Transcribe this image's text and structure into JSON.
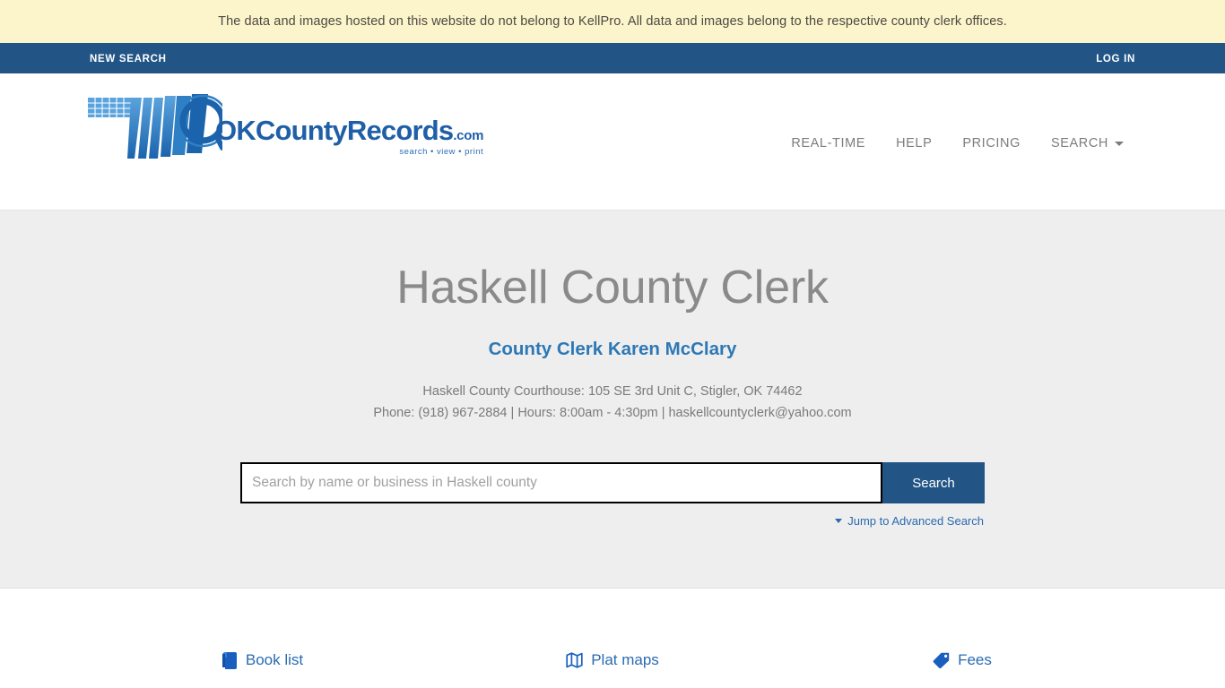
{
  "disclaimer": {
    "text": "The data and images hosted on this website do not belong to KellPro. All data and images belong to the respective county clerk offices."
  },
  "topnav": {
    "new_search_label": "NEW SEARCH",
    "log_in_label": "LOG IN"
  },
  "logo": {
    "word_main": "OKCountyRecords",
    "word_suffix": ".com",
    "tagline": "search • view • print",
    "trademark": "™"
  },
  "menu": {
    "items": [
      {
        "label": "REAL-TIME"
      },
      {
        "label": "HELP"
      },
      {
        "label": "PRICING"
      },
      {
        "label": "SEARCH"
      }
    ]
  },
  "hero": {
    "title": "Haskell County Clerk",
    "clerk_link": "County Clerk Karen McClary",
    "address_line": "Haskell County Courthouse: 105 SE 3rd Unit C, Stigler, OK 74462",
    "contact_line": "Phone: (918) 967-2884 | Hours: 8:00am - 4:30pm | haskellcountyclerk@yahoo.com"
  },
  "search": {
    "placeholder": "Search by name or business in Haskell county",
    "value": "",
    "button_label": "Search",
    "advanced_label": "Jump to Advanced Search"
  },
  "quicklinks": [
    {
      "label": "Book list",
      "icon": "book-icon"
    },
    {
      "label": "Plat maps",
      "icon": "map-icon"
    },
    {
      "label": "Fees",
      "icon": "tag-icon"
    }
  ],
  "colors": {
    "nav_blue": "#225586",
    "banner_yellow": "#fcf4cb",
    "link_blue": "#2a6bb0",
    "hero_gray": "#eeeeee",
    "title_gray": "#8a8a8a"
  }
}
